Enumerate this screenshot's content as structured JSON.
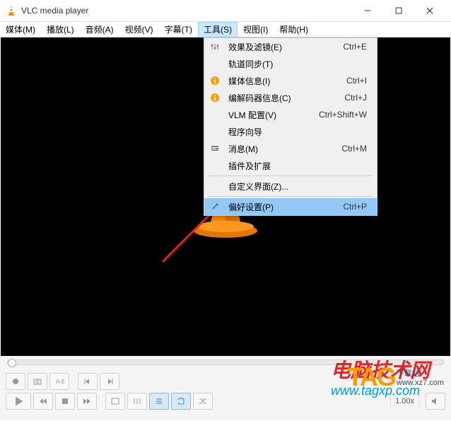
{
  "title_bar": {
    "title": "VLC media player"
  },
  "menu_bar": {
    "items": [
      {
        "label": "媒体(M)"
      },
      {
        "label": "播放(L)"
      },
      {
        "label": "音频(A)"
      },
      {
        "label": "视频(V)"
      },
      {
        "label": "字幕(T)"
      },
      {
        "label": "工具(S)"
      },
      {
        "label": "视图(I)"
      },
      {
        "label": "帮助(H)"
      }
    ]
  },
  "dropdown": {
    "items": [
      {
        "label": "效果及滤镜(E)",
        "shortcut": "Ctrl+E",
        "icon": "sliders"
      },
      {
        "label": "轨道同步(T)",
        "shortcut": "",
        "icon": ""
      },
      {
        "label": "媒体信息(I)",
        "shortcut": "Ctrl+I",
        "icon": "info"
      },
      {
        "label": "编解码器信息(C)",
        "shortcut": "Ctrl+J",
        "icon": "info"
      },
      {
        "label": "VLM 配置(V)",
        "shortcut": "Ctrl+Shift+W",
        "icon": ""
      },
      {
        "label": "程序向导",
        "shortcut": "",
        "icon": ""
      },
      {
        "label": "消息(M)",
        "shortcut": "Ctrl+M",
        "icon": "messages"
      },
      {
        "label": "插件及扩展",
        "shortcut": "",
        "icon": ""
      }
    ],
    "items2": [
      {
        "label": "自定义界面(Z)...",
        "shortcut": "",
        "icon": ""
      }
    ],
    "items3": [
      {
        "label": "偏好设置(P)",
        "shortcut": "Ctrl+P",
        "icon": "wrench"
      }
    ]
  },
  "controls": {
    "speed": "1.00x"
  },
  "watermark": {
    "line1": "电脑技术网",
    "line2": "www.tagxp.com",
    "tag": "TAG",
    "sublabel": "下载站",
    "suburl": "www.xz7.com"
  }
}
